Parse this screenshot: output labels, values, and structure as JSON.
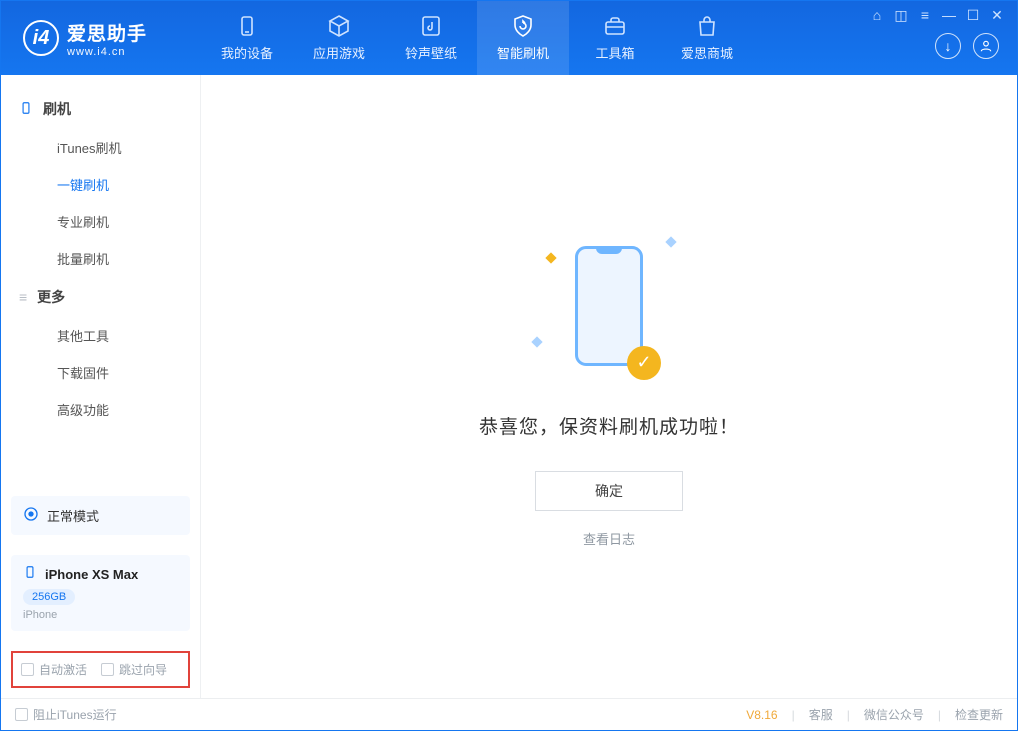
{
  "app": {
    "name_cn": "爱思助手",
    "url": "www.i4.cn"
  },
  "nav": {
    "items": [
      {
        "label": "我的设备"
      },
      {
        "label": "应用游戏"
      },
      {
        "label": "铃声壁纸"
      },
      {
        "label": "智能刷机"
      },
      {
        "label": "工具箱"
      },
      {
        "label": "爱思商城"
      }
    ]
  },
  "sidebar": {
    "sections": [
      {
        "title": "刷机",
        "items": [
          {
            "label": "iTunes刷机"
          },
          {
            "label": "一键刷机",
            "active": true
          },
          {
            "label": "专业刷机"
          },
          {
            "label": "批量刷机"
          }
        ]
      },
      {
        "title": "更多",
        "items": [
          {
            "label": "其他工具"
          },
          {
            "label": "下载固件"
          },
          {
            "label": "高级功能"
          }
        ]
      }
    ],
    "mode": "正常模式",
    "device": {
      "name": "iPhone XS Max",
      "storage": "256GB",
      "type": "iPhone"
    },
    "options": {
      "auto_activate": "自动激活",
      "skip_guide": "跳过向导"
    }
  },
  "main": {
    "message": "恭喜您，保资料刷机成功啦！",
    "confirm_label": "确定",
    "view_log": "查看日志"
  },
  "status": {
    "block_itunes": "阻止iTunes运行",
    "version": "V8.16",
    "links": [
      "客服",
      "微信公众号",
      "检查更新"
    ]
  },
  "colors": {
    "primary": "#1576f0",
    "accent": "#f4b61f",
    "highlight_border": "#e1433b"
  }
}
